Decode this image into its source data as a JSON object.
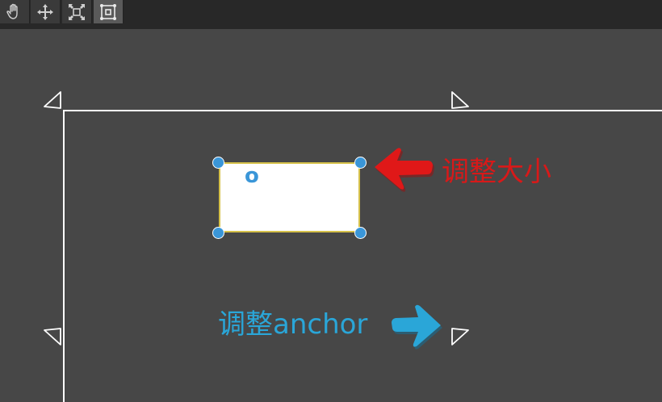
{
  "toolbar": {
    "tools": [
      {
        "name": "hand-tool",
        "icon": "hand-icon",
        "active": false
      },
      {
        "name": "move-tool",
        "icon": "move-icon",
        "active": false
      },
      {
        "name": "scale-tool",
        "icon": "scale-icon",
        "active": false
      },
      {
        "name": "rect-tool",
        "icon": "rect-transform-icon",
        "active": true
      }
    ]
  },
  "canvas": {
    "widget_label": "o"
  },
  "annotations": {
    "resize_label": "调整大小",
    "anchor_label": "调整anchor"
  },
  "colors": {
    "background": "#474747",
    "toolbar": "#282828",
    "handle": "#3a96d8",
    "selection_border": "#d6c14a",
    "resize_annotation": "#d81919",
    "anchor_annotation": "#2aa6d8"
  }
}
